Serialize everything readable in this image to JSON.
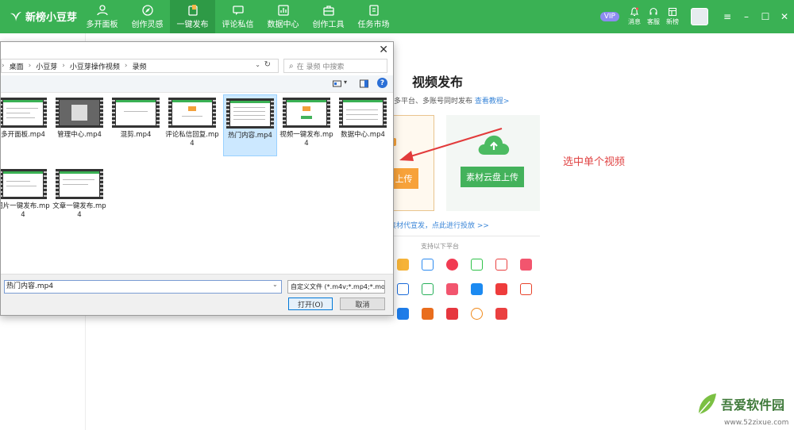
{
  "app": {
    "name": "新榜小豆芽",
    "nav": [
      {
        "label": "多开面板",
        "icon": "people-icon"
      },
      {
        "label": "创作灵感",
        "icon": "compass-icon"
      },
      {
        "label": "一键发布",
        "icon": "publish-icon"
      },
      {
        "label": "评论私信",
        "icon": "chat-icon"
      },
      {
        "label": "数据中心",
        "icon": "chart-icon"
      },
      {
        "label": "创作工具",
        "icon": "toolbox-icon"
      },
      {
        "label": "任务市场",
        "icon": "task-icon"
      }
    ],
    "active_nav": "一键发布",
    "vip_label": "VIP",
    "tools": [
      {
        "label": "消息",
        "icon": "bell-icon"
      },
      {
        "label": "客服",
        "icon": "headset-icon"
      },
      {
        "label": "新榜",
        "icon": "board-icon"
      }
    ],
    "accent": "#3ab154"
  },
  "publish": {
    "title": "视频发布",
    "subtitle_tail": "、多平台、多账号同时发布",
    "tutorial_link": "查看教程>",
    "local_upload_fragment": "上传",
    "cloud_upload_label": "素材云盘上传",
    "promo_text": "素材代宣发，点此进行投放 >>",
    "platforms_label": "支持以下平台"
  },
  "annotation": "选中单个视频",
  "dialog": {
    "breadcrumb": [
      "桌面",
      "小豆芽",
      "小豆芽操作视频",
      "录频"
    ],
    "search_placeholder": "在 录频 中搜索",
    "files": [
      {
        "name": "多开面板.mp4"
      },
      {
        "name": "管理中心.mp4"
      },
      {
        "name": "混剪.mp4"
      },
      {
        "name": "评论私信回复.mp4"
      },
      {
        "name": "热门内容.mp4",
        "selected": true
      },
      {
        "name": "视频一键发布.mp4"
      },
      {
        "name": "数据中心.mp4"
      },
      {
        "name": "图片一键发布.mp4"
      },
      {
        "name": "文章一键发布.mp4"
      }
    ],
    "filename_value": "热门内容.mp4",
    "filetype_value": "自定义文件 (*.m4v;*.mp4;*.mov",
    "open_label": "打开(O)",
    "cancel_label": "取消"
  },
  "watermark": {
    "text": "吾爱软件园",
    "sub": "www.52zixue.com"
  }
}
